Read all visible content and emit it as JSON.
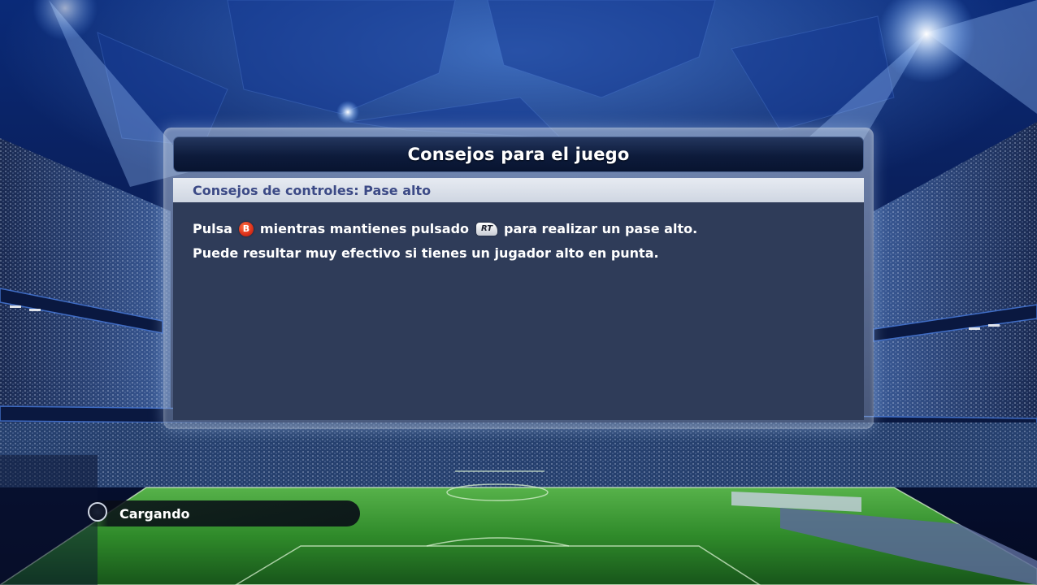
{
  "tips_dialog": {
    "title": "Consejos para el juego",
    "category": "Consejos de controles: Pase alto",
    "line1_part1": "Pulsa",
    "button_b": "B",
    "line1_part2": "mientras mantienes pulsado",
    "button_rt": "RT",
    "line1_part3": "para realizar un pase alto.",
    "line2": "Puede resultar muy efectivo si tienes un jugador alto en punta."
  },
  "loading": {
    "label": "Cargando"
  },
  "colors": {
    "title_bar": "#0d1b3b",
    "subtitle_bar": "#dfe4ec",
    "subtitle_text": "#3c4a86",
    "body_bg": "#2f3c59",
    "button_b": "#e0341c",
    "pitch_green": "#2f8a2a"
  }
}
